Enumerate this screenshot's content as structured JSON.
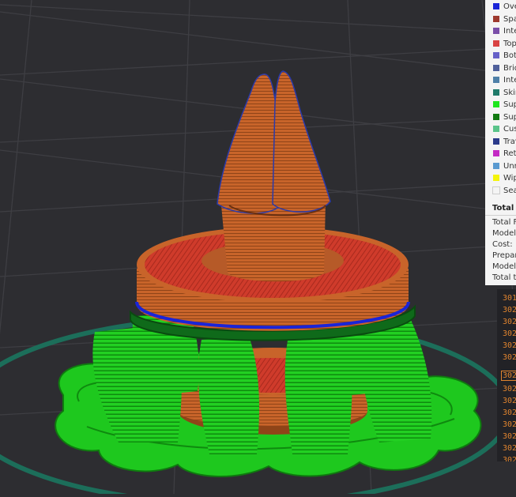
{
  "legend": {
    "items": [
      {
        "label": "Ove",
        "color": "#1a24d8"
      },
      {
        "label": "Spa",
        "color": "#9e3a2e"
      },
      {
        "label": "Inte",
        "color": "#7a4ea8"
      },
      {
        "label": "Top",
        "color": "#d94343"
      },
      {
        "label": "Bott",
        "color": "#6660c8"
      },
      {
        "label": "Brid",
        "color": "#4f5f9a"
      },
      {
        "label": "Inte",
        "color": "#4e7fa8"
      },
      {
        "label": "Skir",
        "color": "#1f7a6a"
      },
      {
        "label": "Sup",
        "color": "#1ee61e"
      },
      {
        "label": "Sup",
        "color": "#127a12"
      },
      {
        "label": "Cus",
        "color": "#5ac48a"
      },
      {
        "label": "Trav",
        "color": "#2a3a8a"
      },
      {
        "label": "Retr",
        "color": "#c42ac4"
      },
      {
        "label": "Unr",
        "color": "#5a9ad0"
      },
      {
        "label": "Wip",
        "color": "#f4f40a"
      },
      {
        "label": "Sea",
        "color": "#f4f4f4"
      }
    ]
  },
  "stats": {
    "title": "Total e",
    "rows": [
      "Total F",
      "Model",
      "Cost:",
      "Prepar",
      "Model",
      "Total ti"
    ]
  },
  "gcode": {
    "lines": [
      "301",
      "302",
      "302",
      "302",
      "302",
      "302",
      "302",
      "302",
      "302",
      "302",
      "302",
      "302",
      "302",
      "302"
    ],
    "current_index": 6
  },
  "colors": {
    "background": "#2d2d31",
    "grid": "#3e3e43",
    "model_orange": "#c8642a",
    "top_red": "#d03c2c",
    "support_green": "#1fcf1f",
    "skirt": "#1c6e5a"
  }
}
